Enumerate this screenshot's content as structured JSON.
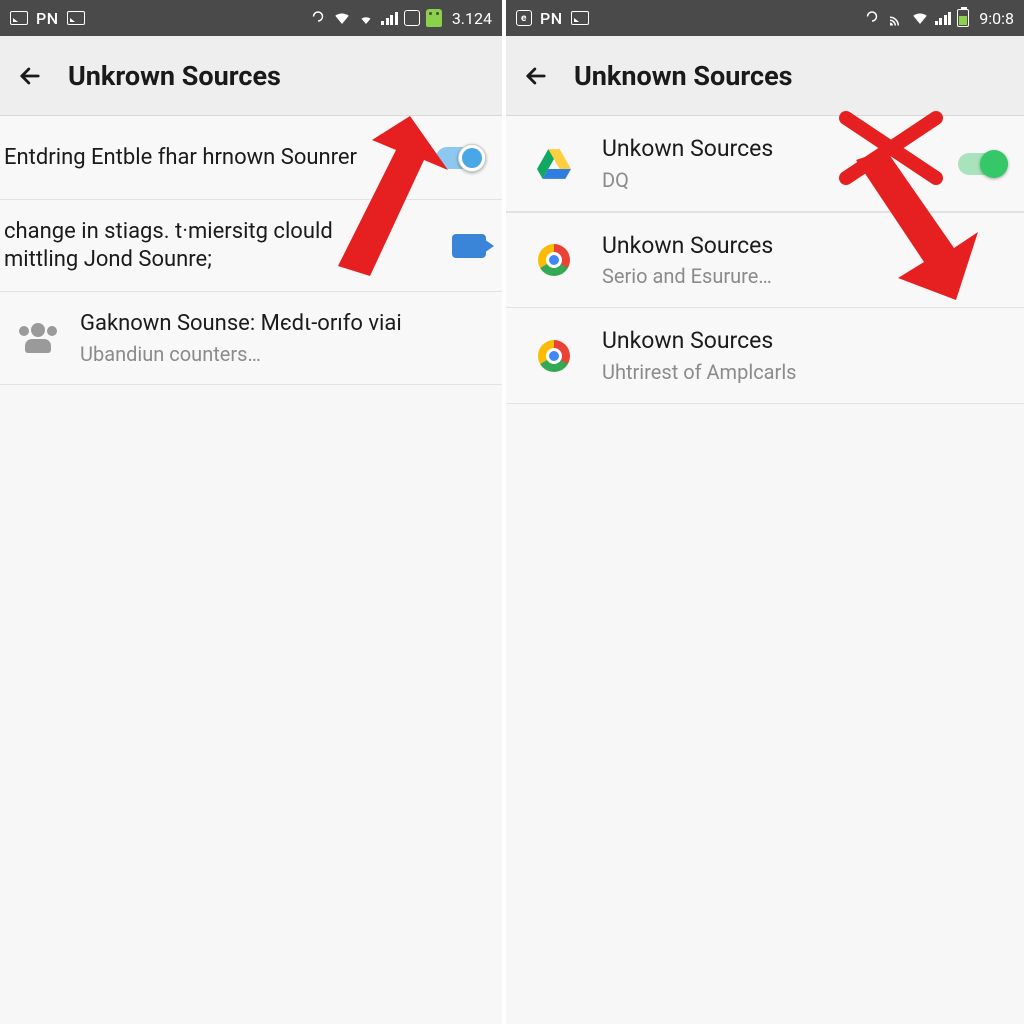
{
  "left": {
    "status": {
      "pn": "PN",
      "time": "3.124"
    },
    "appbar": {
      "title": "Unkrown Sources"
    },
    "rows": [
      {
        "primary": "Entdring Entble fhar hrnown Sounrer"
      },
      {
        "primary": "change in stiags. t·miersitg clould  mittling Jond Sounre;"
      },
      {
        "primary": "Gaknown Sounse: Mєdι-orıfo viai",
        "secondary": "Ubandiun counters…"
      }
    ]
  },
  "right": {
    "status": {
      "pn": "PN",
      "time": "9:0:8"
    },
    "appbar": {
      "title": "Unknown Sources"
    },
    "rows": [
      {
        "primary": "Unkown Sources",
        "secondary": "DQ"
      },
      {
        "primary": "Unkown Sources",
        "secondary": "Serio and Esurure…"
      },
      {
        "primary": "Unkown Sources",
        "secondary": "Uhtrirest of Amplcarls"
      }
    ]
  }
}
